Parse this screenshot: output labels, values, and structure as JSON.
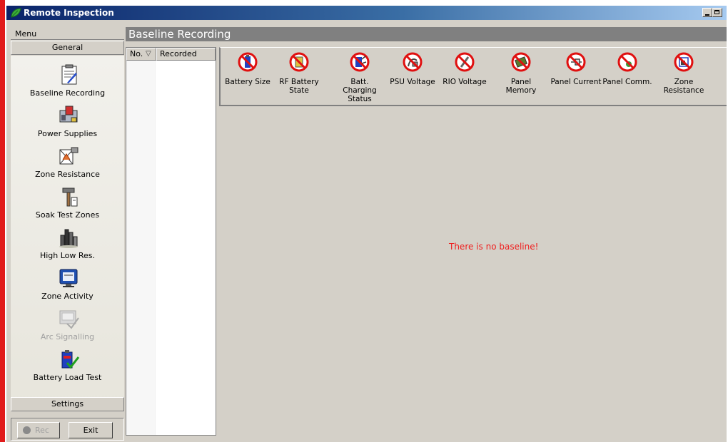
{
  "window": {
    "title": "Remote Inspection"
  },
  "menu": {
    "header": "Menu",
    "groups": {
      "general": "General",
      "settings": "Settings"
    },
    "items": [
      {
        "label": "Baseline Recording",
        "icon": "clipboard-icon"
      },
      {
        "label": "Power Supplies",
        "icon": "power-supply-icon"
      },
      {
        "label": "Zone Resistance",
        "icon": "zone-resistance-icon"
      },
      {
        "label": "Soak Test Zones",
        "icon": "hammer-icon"
      },
      {
        "label": "High Low Res.",
        "icon": "bar-chart-icon"
      },
      {
        "label": "Zone Activity",
        "icon": "monitor-icon"
      },
      {
        "label": "Arc Signalling",
        "icon": "arc-signalling-icon"
      },
      {
        "label": "Battery Load Test",
        "icon": "battery-check-icon"
      }
    ],
    "buttons": {
      "rec": "Rec",
      "exit": "Exit"
    }
  },
  "main": {
    "title": "Baseline Recording",
    "columns": {
      "no": "No.",
      "recorded": "Recorded"
    },
    "toolbar": [
      {
        "label": "Battery Size",
        "icon": "battery-size-icon"
      },
      {
        "label": "RF Battery State",
        "icon": "rf-battery-icon"
      },
      {
        "label": "Batt. Charging Status",
        "icon": "battery-charging-icon"
      },
      {
        "label": "PSU Voltage",
        "icon": "psu-voltage-icon"
      },
      {
        "label": "RIO Voltage",
        "icon": "rio-voltage-icon"
      },
      {
        "label": "Panel Memory",
        "icon": "panel-memory-icon"
      },
      {
        "label": "Panel Current",
        "icon": "panel-current-icon"
      },
      {
        "label": "Panel Comm.",
        "icon": "panel-comm-icon"
      },
      {
        "label": "Zone Resistance",
        "icon": "zone-resistance-icon"
      }
    ],
    "message": "There is no baseline!"
  },
  "colors": {
    "message": "#ef1e1e",
    "titlebar": "#0a246a",
    "prohibited": "#e01010"
  }
}
